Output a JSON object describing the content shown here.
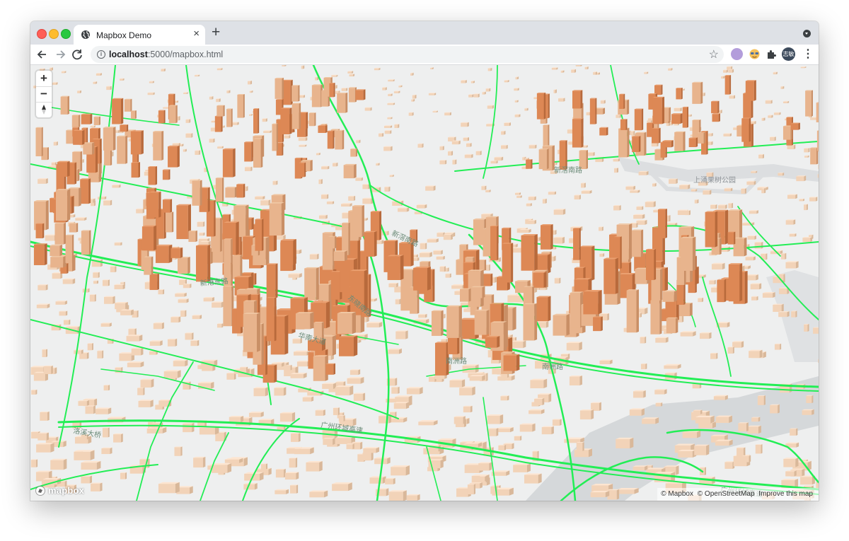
{
  "browser": {
    "tab_title": "Mapbox Demo",
    "tab_close": "×",
    "new_tab": "+",
    "url_host": "localhost",
    "url_rest": ":5000/mapbox.html",
    "avatar_text": "志敏",
    "icons": {
      "back": "back-arrow-icon",
      "forward": "forward-arrow-icon",
      "reload": "reload-icon",
      "info": "info-icon",
      "bookmark": "star-icon",
      "extensions": "puzzle-icon",
      "menu": "kebab-menu-icon",
      "tab": "globe-icon"
    }
  },
  "map": {
    "controls": {
      "zoom_in": "+",
      "zoom_out": "−",
      "compass": "compass-icon"
    },
    "logo_text": "mapbox",
    "attribution": [
      "© Mapbox",
      "© OpenStreetMap",
      "Improve this map"
    ],
    "labels": [
      "上涌果树公园",
      "南洲路",
      "南洲路",
      "广州环城高速",
      "广州环城高速",
      "新滘南路",
      "新滘南路",
      "华南大道",
      "东晓南路",
      "洛溪大桥",
      "新港东路"
    ],
    "colors": {
      "roads": "#22ee55",
      "building_low": "#fde5d0",
      "building_mid": "#e8b48d",
      "building_high": "#dd8855",
      "water": "#d5d8da",
      "ground": "#eeefef"
    }
  }
}
